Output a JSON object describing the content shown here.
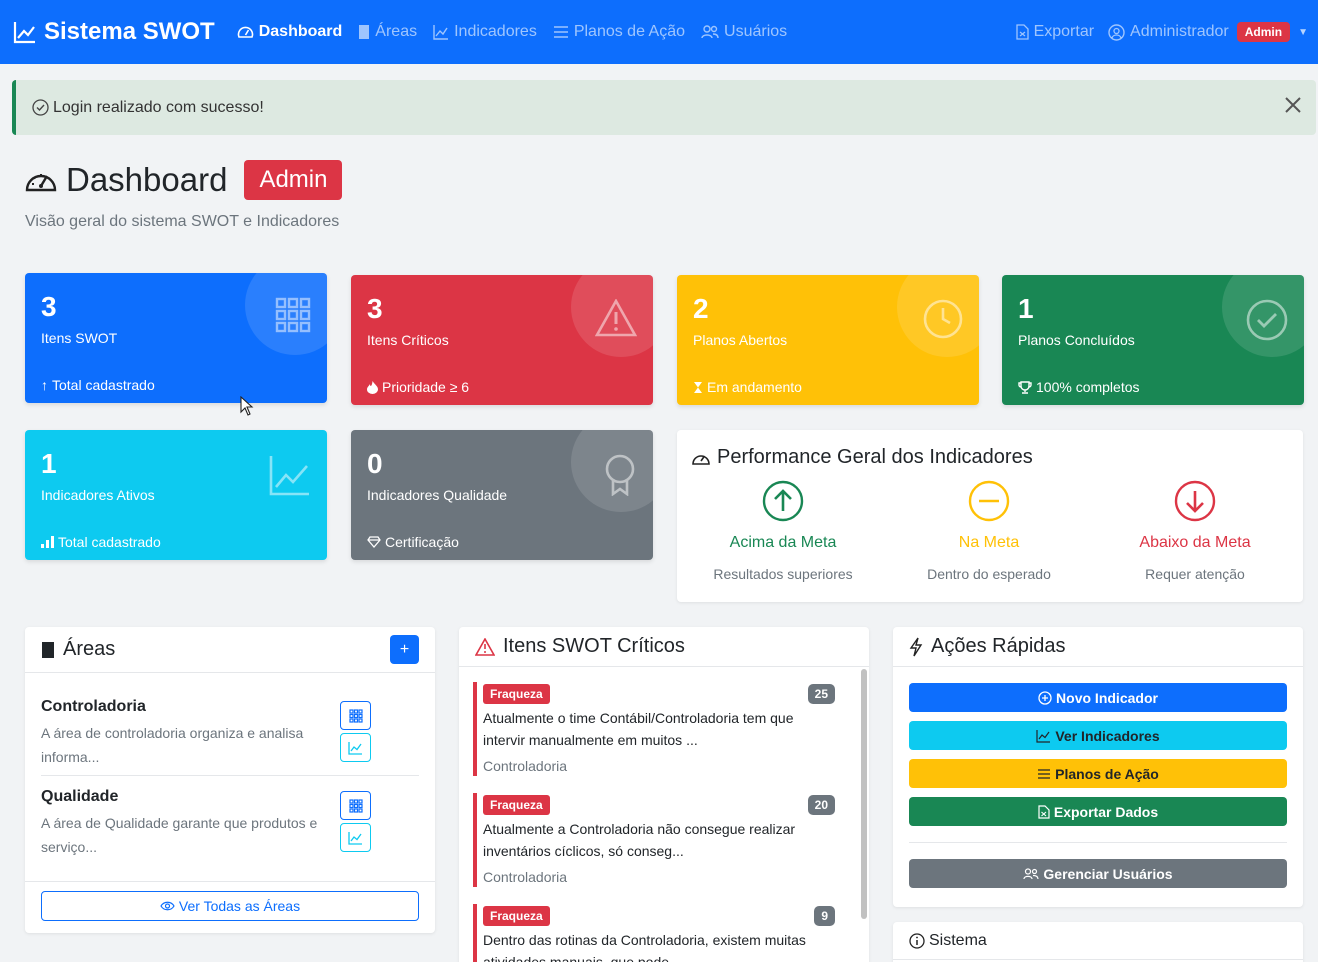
{
  "navbar": {
    "brand": "Sistema SWOT",
    "links": [
      {
        "label": "Dashboard",
        "icon": "speedometer-icon",
        "active": true
      },
      {
        "label": "Áreas",
        "icon": "bookmark-icon",
        "active": false
      },
      {
        "label": "Indicadores",
        "icon": "graph-up-icon",
        "active": false
      },
      {
        "label": "Planos de Ação",
        "icon": "list-icon",
        "active": false
      },
      {
        "label": "Usuários",
        "icon": "people-icon",
        "active": false
      }
    ],
    "export_label": "Exportar",
    "user_label": "Administrador",
    "role_badge": "Admin"
  },
  "alert": {
    "message": "Login realizado com sucesso!"
  },
  "header": {
    "title": "Dashboard",
    "badge": "Admin",
    "subtitle": "Visão geral do sistema SWOT e Indicadores"
  },
  "stats": [
    {
      "value": "3",
      "label": "Itens SWOT",
      "footer": "Total cadastrado",
      "color": "#0d6efd",
      "icon": "grid-icon"
    },
    {
      "value": "3",
      "label": "Itens Críticos",
      "footer": "Prioridade ≥ 6",
      "color": "#dc3545",
      "icon": "warning-icon"
    },
    {
      "value": "2",
      "label": "Planos Abertos",
      "footer": "Em andamento",
      "color": "#ffc107",
      "icon": "clock-icon"
    },
    {
      "value": "1",
      "label": "Planos Concluídos",
      "footer": "100% completos",
      "color": "#198754",
      "icon": "check-circle-icon"
    },
    {
      "value": "1",
      "label": "Indicadores Ativos",
      "footer": "Total cadastrado",
      "color": "#0dcaf0",
      "icon": "graph-up-icon"
    },
    {
      "value": "0",
      "label": "Indicadores Qualidade",
      "footer": "Certificação",
      "color": "#6c757d",
      "icon": "award-icon"
    }
  ],
  "performance": {
    "title": "Performance Geral dos Indicadores",
    "columns": [
      {
        "title": "Acima da Meta",
        "subtitle": "Resultados superiores",
        "color": "#198754"
      },
      {
        "title": "Na Meta",
        "subtitle": "Dentro do esperado",
        "color": "#ffc107"
      },
      {
        "title": "Abaixo da Meta",
        "subtitle": "Requer atenção",
        "color": "#dc3545"
      }
    ]
  },
  "areas": {
    "title": "Áreas",
    "add_label": "+",
    "items": [
      {
        "name": "Controladoria",
        "desc_line1": "A área de controladoria organiza e analisa",
        "desc_line2": "informa..."
      },
      {
        "name": "Qualidade",
        "desc_line1": "A área de Qualidade garante que produtos e",
        "desc_line2": "serviço..."
      }
    ],
    "view_all": "Ver Todas as Áreas"
  },
  "swot": {
    "title": "Itens SWOT Críticos",
    "items": [
      {
        "tag": "Fraqueza",
        "priority": "25",
        "line1": "Atualmente o time Contábil/Controladoria tem que",
        "line2": "intervir manualmente em muitos ...",
        "area": "Controladoria"
      },
      {
        "tag": "Fraqueza",
        "priority": "20",
        "line1": "Atualmente a Controladoria não consegue realizar",
        "line2": "inventários cíclicos, só conseg...",
        "area": "Controladoria"
      },
      {
        "tag": "Fraqueza",
        "priority": "9",
        "line1": "Dentro das rotinas da Controladoria, existem muitas",
        "line2": "atividades manuais, que pode...",
        "area": ""
      }
    ]
  },
  "quick": {
    "title": "Ações Rápidas",
    "buttons": [
      {
        "label": "Novo Indicador",
        "bg": "#0d6efd",
        "fg": "#ffffff",
        "icon": "plus-circle-icon"
      },
      {
        "label": "Ver Indicadores",
        "bg": "#0dcaf0",
        "fg": "#212529",
        "icon": "graph-up-icon"
      },
      {
        "label": "Planos de Ação",
        "bg": "#ffc107",
        "fg": "#212529",
        "icon": "list-icon"
      },
      {
        "label": "Exportar Dados",
        "bg": "#198754",
        "fg": "#ffffff",
        "icon": "file-icon"
      }
    ],
    "manage_users": "Gerenciar Usuários"
  },
  "system": {
    "title": "Sistema"
  }
}
